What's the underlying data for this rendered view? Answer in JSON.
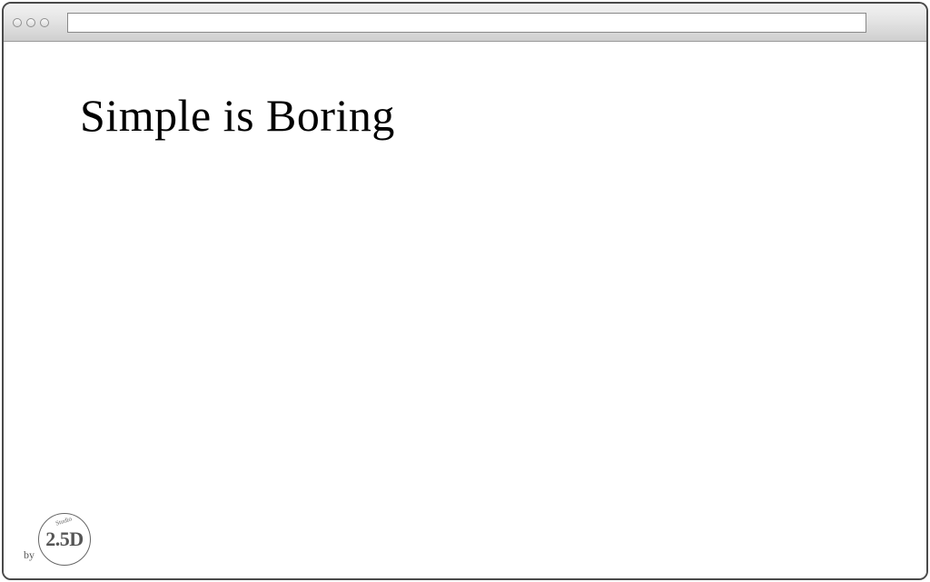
{
  "content": {
    "headline": "Simple is Boring"
  },
  "credit": {
    "by_label": "by",
    "logo_main": "2.5D",
    "logo_sub": "Studio"
  },
  "address_bar": {
    "value": ""
  }
}
